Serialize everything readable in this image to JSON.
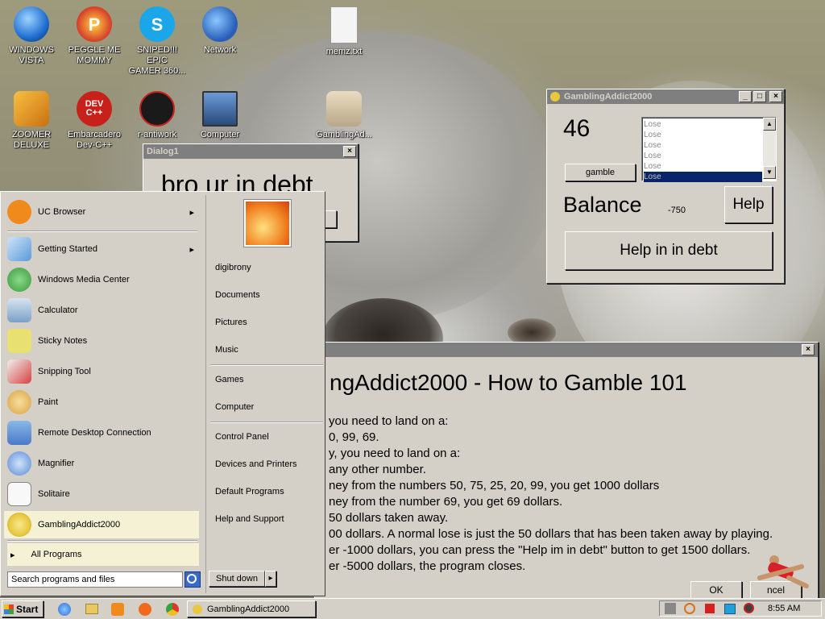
{
  "desktop": {
    "icons": [
      {
        "label1": "WINDOWS",
        "label2": "VISTA",
        "icon": "vista-orb-icon",
        "color": "#1f6fd1"
      },
      {
        "label1": "PEGGLE ME",
        "label2": "MOMMY",
        "icon": "peggle-icon",
        "color": "#d63b2a"
      },
      {
        "label1": "SNIPED!!! EPIC",
        "label2": "GAMER 360...",
        "icon": "skype-icon",
        "color": "#1aa6e8"
      },
      {
        "label1": "Network",
        "label2": "",
        "icon": "network-icon",
        "color": "#2a5fb8"
      },
      {
        "label1": "memz.txt",
        "label2": "",
        "icon": "text-file-icon",
        "color": "#e8e8e8"
      },
      {
        "label1": "ZOOMER",
        "label2": "DELUXE",
        "icon": "zuma-icon",
        "color": "#e8a020"
      },
      {
        "label1": "Embarcadero",
        "label2": "Dev-C++",
        "icon": "devcpp-icon",
        "color": "#c8201a"
      },
      {
        "label1": "r-antiwork",
        "label2": "",
        "icon": "antiwork-icon",
        "color": "#1a1a1a"
      },
      {
        "label1": "Computer",
        "label2": "",
        "icon": "computer-icon",
        "color": "#2a4a7a"
      },
      {
        "label1": "GamblingAd...",
        "label2": "",
        "icon": "folder-icon",
        "color": "#d8c8a8"
      }
    ]
  },
  "dialog1": {
    "title": "Dialog1",
    "message": "bro ur in debt",
    "close": "×"
  },
  "gambling_window": {
    "title": "GamblingAddict2000",
    "number": "46",
    "gamble_label": "gamble",
    "results": [
      "Lose",
      "Lose",
      "Lose",
      "Lose",
      "Lose",
      "Lose"
    ],
    "balance_label": "Balance",
    "balance_value": "-750",
    "help_label": "Help",
    "debt_help_label": "Help in in debt",
    "min": "_",
    "max": "□",
    "close": "×"
  },
  "howto_window": {
    "close": "×",
    "heading": "ngAddict2000 - How to Gamble 101",
    "lines": [
      "you need to land on a:",
      "0, 99, 69.",
      "y, you need to land on a:",
      "any other number.",
      "ney from the numbers 50, 75, 25, 20, 99, you get 1000 dollars",
      "ney from the number 69, you get 69 dollars.",
      "50 dollars taken away.",
      "00 dollars. A normal lose is just the 50 dollars that has been taken away by playing.",
      "er -1000 dollars, you can press the \"Help im in debt\" button to get 1500 dollars.",
      "er -5000 dollars, the program closes."
    ],
    "ok_label": "OK",
    "cancel_label": "ncel"
  },
  "start_menu": {
    "left_items": [
      {
        "label": "UC Browser",
        "icon": "uc-browser-icon",
        "color": "#f08a1c",
        "arrow": "▸"
      },
      {
        "label": "Getting Started",
        "icon": "getting-started-icon",
        "color": "#5a9ad8",
        "arrow": "▸"
      },
      {
        "label": "Windows Media Center",
        "icon": "media-center-icon",
        "color": "#3c9a3c",
        "arrow": ""
      },
      {
        "label": "Calculator",
        "icon": "calculator-icon",
        "color": "#7aa0c8",
        "arrow": ""
      },
      {
        "label": "Sticky Notes",
        "icon": "sticky-notes-icon",
        "color": "#e8e070",
        "arrow": ""
      },
      {
        "label": "Snipping Tool",
        "icon": "snipping-tool-icon",
        "color": "#d84040",
        "arrow": ""
      },
      {
        "label": "Paint",
        "icon": "paint-icon",
        "color": "#d8a040",
        "arrow": ""
      },
      {
        "label": "Remote Desktop Connection",
        "icon": "remote-desktop-icon",
        "color": "#4a7ac8",
        "arrow": ""
      },
      {
        "label": "Magnifier",
        "icon": "magnifier-icon",
        "color": "#5a8ad8",
        "arrow": ""
      },
      {
        "label": "Solitaire",
        "icon": "solitaire-icon",
        "color": "#f0f0f0",
        "arrow": ""
      },
      {
        "label": "GamblingAddict2000",
        "icon": "gambling-coin-icon",
        "color": "#e8c840",
        "arrow": ""
      }
    ],
    "all_programs": "All Programs",
    "all_programs_arrow": "▸",
    "search_placeholder": "Search programs and files",
    "right_items": [
      "digibrony",
      "Documents",
      "Pictures",
      "Music",
      "Games",
      "Computer",
      "Control Panel",
      "Devices and Printers",
      "Default Programs",
      "Help and Support"
    ],
    "shutdown_label": "Shut down",
    "shutdown_arrow": "▸"
  },
  "taskbar": {
    "start_label": "Start",
    "task_label": "GamblingAddict2000",
    "clock": "8:55 AM"
  }
}
